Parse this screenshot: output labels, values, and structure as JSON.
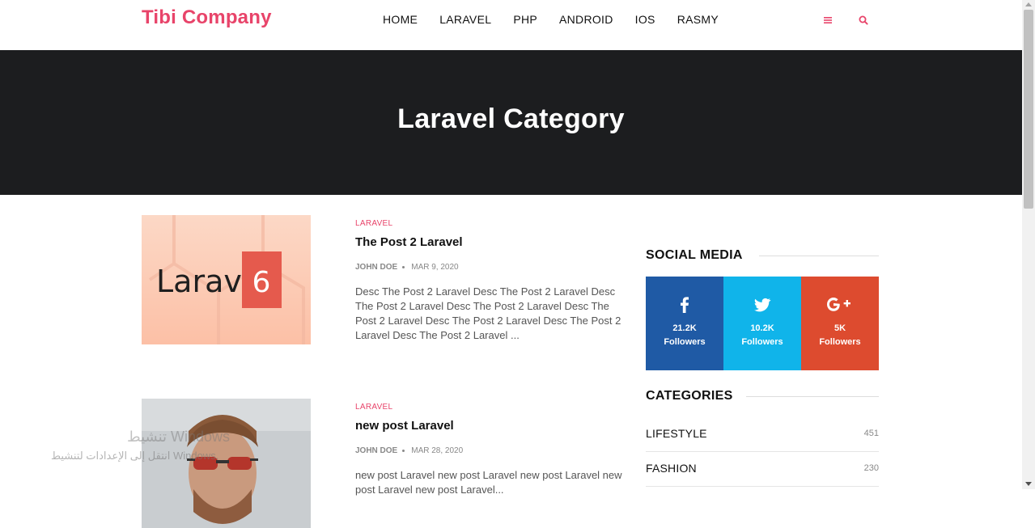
{
  "header": {
    "logo": "Tibi Company",
    "nav": [
      "HOME",
      "LARAVEL",
      "PHP",
      "ANDROID",
      "IOS",
      "RASMY"
    ],
    "icons": [
      "menu-icon",
      "search-icon"
    ]
  },
  "hero": {
    "title": "Laravel Category"
  },
  "posts": [
    {
      "category": "LARAVEL",
      "title": "The Post 2 Laravel",
      "author": "JOHN DOE",
      "date": "MAR 9, 2020",
      "description": "Desc The Post 2 Laravel Desc The Post 2 Laravel Desc The Post 2 Laravel Desc The Post 2 Laravel Desc The Post 2 Laravel Desc The Post 2 Laravel Desc The Post 2 Laravel Desc The Post 2 Laravel ...",
      "image_text": "Laravel",
      "image_badge": "6"
    },
    {
      "category": "LARAVEL",
      "title": "new post Laravel",
      "author": "JOHN DOE",
      "date": "MAR 28, 2020",
      "description": "new post Laravel new post Laravel new post Laravel new post Laravel new post Laravel..."
    }
  ],
  "sidebar": {
    "social_title": "SOCIAL MEDIA",
    "social": [
      {
        "network": "facebook",
        "icon": "facebook-icon",
        "count": "21.2K",
        "label": "Followers",
        "color": "#1f5aa5"
      },
      {
        "network": "twitter",
        "icon": "twitter-icon",
        "count": "10.2K",
        "label": "Followers",
        "color": "#10b4ea"
      },
      {
        "network": "google-plus",
        "icon": "google-plus-icon",
        "count": "5K",
        "label": "Followers",
        "color": "#dd4b2f"
      }
    ],
    "categories_title": "CATEGORIES",
    "categories": [
      {
        "name": "LIFESTYLE",
        "count": "451"
      },
      {
        "name": "FASHION",
        "count": "230"
      }
    ]
  },
  "watermark": {
    "line1": "تنشيط Windows",
    "line2": "انتقل إلى الإعدادات لتنشيط Windows."
  },
  "colors": {
    "accent": "#e8446a",
    "hero_bg": "#1c1d1f"
  }
}
